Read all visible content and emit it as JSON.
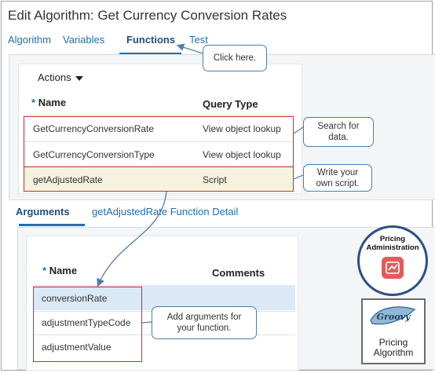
{
  "window": {
    "title": "Edit Algorithm: Get Currency Conversion Rates"
  },
  "tabs": [
    {
      "label": "Algorithm",
      "active": false
    },
    {
      "label": "Variables",
      "active": false
    },
    {
      "label": "Functions",
      "active": true
    },
    {
      "label": "Test",
      "active": false
    }
  ],
  "functions": {
    "actions_label": "Actions",
    "columns": {
      "required_marker": "*",
      "name": "Name",
      "query_type": "Query Type"
    },
    "rows": [
      {
        "name": "GetCurrencyConversionRate",
        "query_type": "View object lookup"
      },
      {
        "name": "GetCurrencyConversionType",
        "query_type": "View object lookup"
      },
      {
        "name": "getAdjustedRate",
        "query_type": "Script",
        "selected": true
      }
    ]
  },
  "subtabs": [
    {
      "label": "Arguments",
      "active": true
    },
    {
      "label": "getAdjustedRate Function Detail",
      "active": false
    }
  ],
  "arguments": {
    "columns": {
      "required_marker": "*",
      "name": "Name",
      "comments": "Comments"
    },
    "rows": [
      {
        "name": "conversionRate",
        "selected": true
      },
      {
        "name": "adjustmentTypeCode"
      },
      {
        "name": "adjustmentValue"
      }
    ]
  },
  "callouts": {
    "click_here": "Click here.",
    "search_line1": "Search for",
    "search_line2": "data.",
    "script_line1": "Write your",
    "script_line2": "own script.",
    "args_line1": "Add arguments for",
    "args_line2": "your function."
  },
  "badges": {
    "pricing_admin_line1": "Pricing",
    "pricing_admin_line2": "Administration",
    "pricing_algo_line1": "Pricing",
    "pricing_algo_line2": "Algorithm",
    "groovy_logo_text": "Groovy"
  },
  "colors": {
    "accent": "#1f6fb2",
    "highlight_box": "#c0302f",
    "callout_border": "#4f7ea8",
    "selected_row": "#dbe9f6",
    "script_row": "#f5f3df",
    "badge_ring": "#2c4f86",
    "badge_icon": "#e05d5a"
  },
  "icons": [
    "caret-down-icon",
    "pricing-admin-icon",
    "groovy-logo-icon"
  ]
}
